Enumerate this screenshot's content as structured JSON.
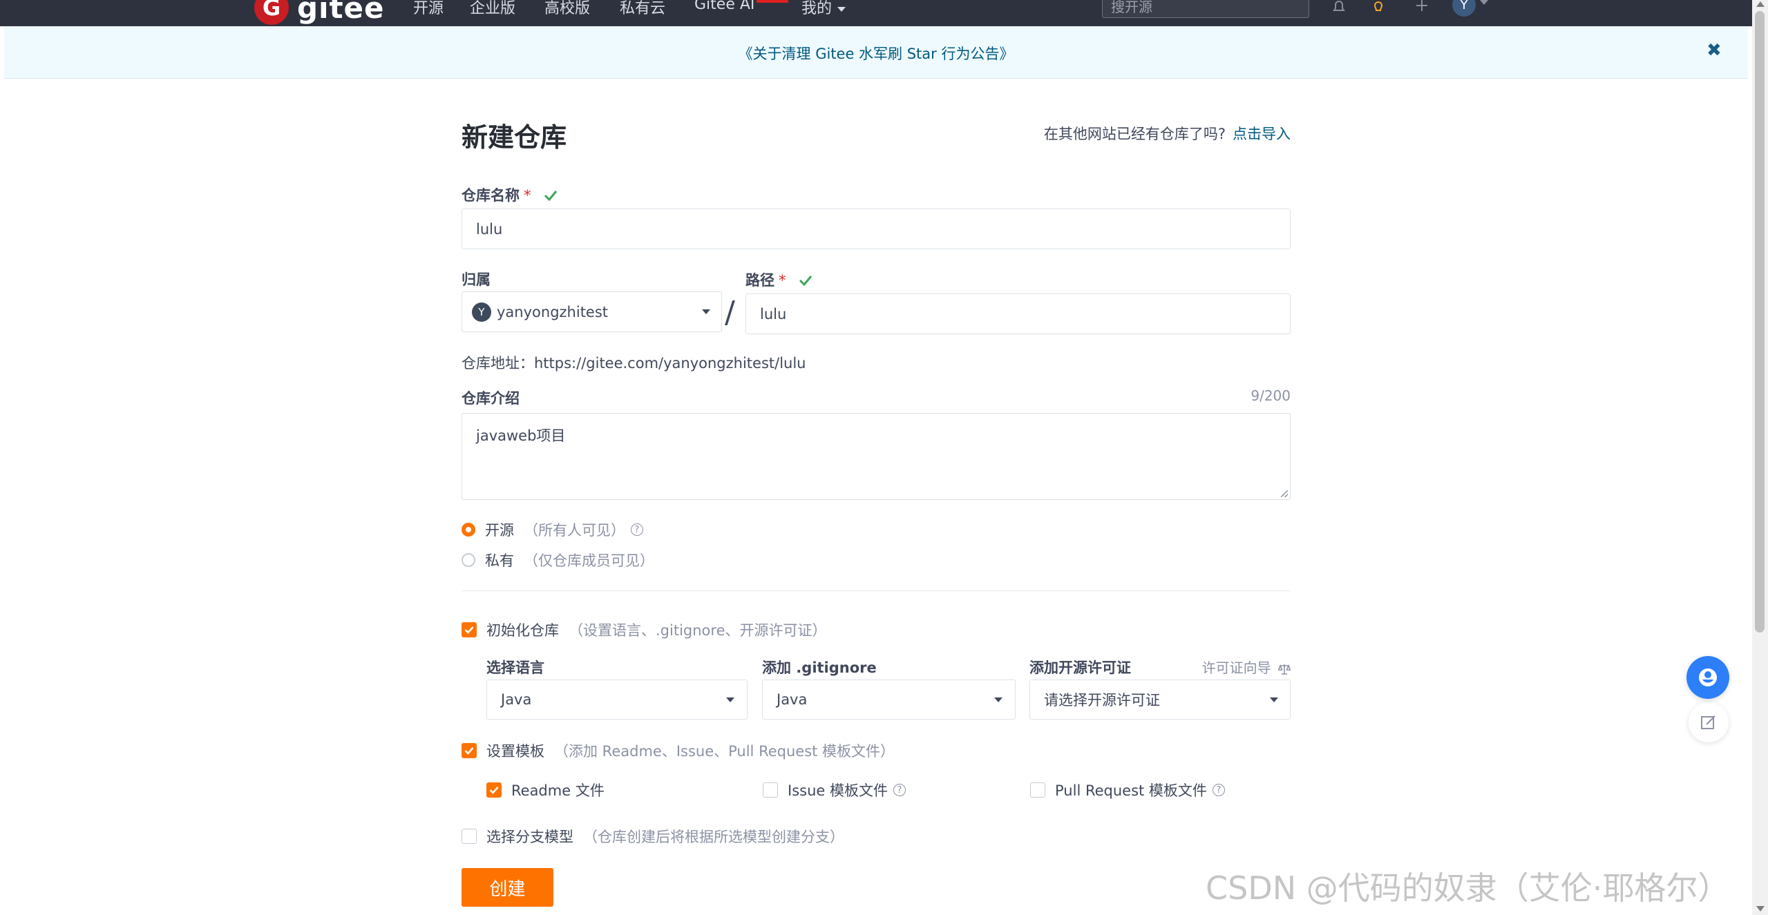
{
  "nav": {
    "logo_letter": "G",
    "logo_text": "gitee",
    "items": [
      "开源",
      "企业版",
      "高校版",
      "私有云",
      "Gitee AI",
      "我的"
    ],
    "search_placeholder": "搜开源",
    "avatar_letter": "Y",
    "icons": [
      "bell-icon",
      "lightbulb-icon",
      "plus-icon"
    ]
  },
  "announcement": {
    "text": "《关于清理 Gitee 水军刷 Star 行为公告》",
    "close": "✖"
  },
  "form": {
    "title": "新建仓库",
    "import_prompt": "在其他网站已经有仓库了吗?",
    "import_link": "点击导入",
    "repo_name_label": "仓库名称",
    "repo_name_value": "lulu",
    "required_mark": "*",
    "owner_label": "归属",
    "owner_avatar": "Y",
    "owner_value": "yanyongzhitest",
    "slash": "/",
    "path_label": "路径",
    "path_value": "lulu",
    "repo_url": "仓库地址：https://gitee.com/yanyongzhitest/lulu",
    "desc_label": "仓库介绍",
    "desc_counter": "9/200",
    "desc_value": "javaweb项目",
    "visibility": {
      "public_label": "开源",
      "public_hint": "（所有人可见）",
      "private_label": "私有",
      "private_hint": "（仅仓库成员可见）",
      "selected": "public"
    },
    "init_repo": {
      "label": "初始化仓库",
      "hint": "（设置语言、.gitignore、开源许可证）",
      "checked": true
    },
    "language_label": "选择语言",
    "language_value": "Java",
    "gitignore_label": "添加 .gitignore",
    "gitignore_value": "Java",
    "license_label": "添加开源许可证",
    "license_guide": "许可证向导",
    "license_placeholder": "请选择开源许可证",
    "template": {
      "label": "设置模板",
      "hint": "（添加 Readme、Issue、Pull Request 模板文件）",
      "checked": true
    },
    "readme_label": "Readme 文件",
    "issue_template_label": "Issue 模板文件",
    "pr_template_label": "Pull Request 模板文件",
    "branch_model": {
      "label": "选择分支模型",
      "hint": "（仓库创建后将根据所选模型创建分支）",
      "checked": false
    },
    "create_button": "创建",
    "help_glyph": "?"
  },
  "watermark": "CSDN @代码的奴隶（艾伦·耶格尔）",
  "colors": {
    "accent": "#fe7300",
    "link": "#005980",
    "navbar": "#2e323f",
    "banner": "#effaff",
    "valid": "#3aa757"
  }
}
